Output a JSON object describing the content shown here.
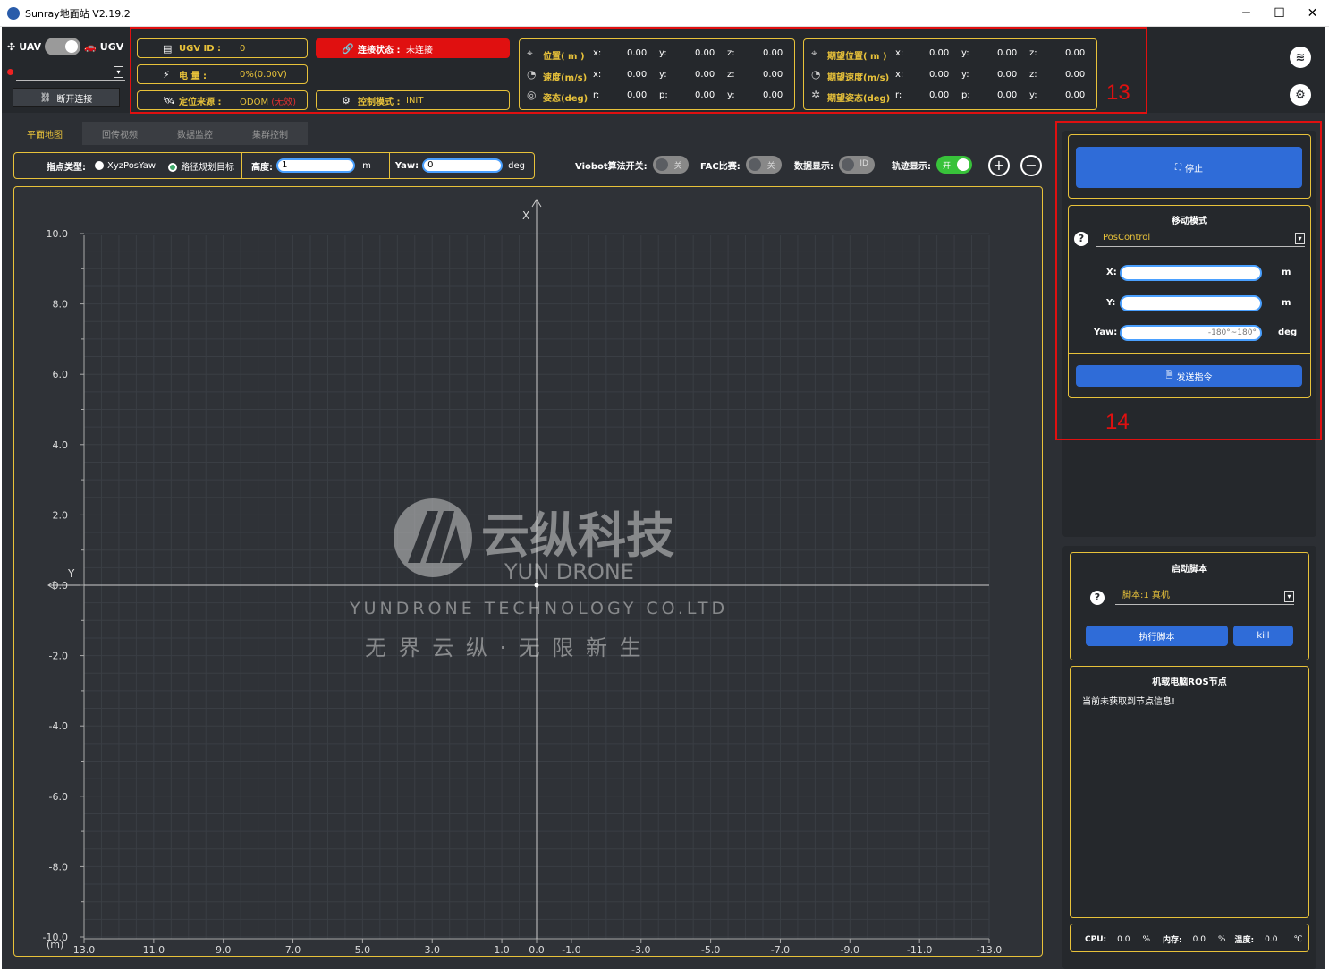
{
  "window": {
    "title": "Sunray地面站 V2.19.2",
    "minimize": "─",
    "maximize": "☐",
    "close": "✕"
  },
  "mode": {
    "uav_label": "UAV",
    "ugv_label": "UGV",
    "disconnect_label": "断开连接"
  },
  "status": {
    "ugv_id_label": "UGV ID :",
    "ugv_id_value": "0",
    "battery_label": "电 量 :",
    "battery_value": "0%(0.00V)",
    "loc_label": "定位来源 :",
    "loc_value": "ODOM",
    "loc_warn": "(无效)",
    "conn_label": "连接状态 :",
    "conn_value": "未连接",
    "ctrl_label": "控制模式 :",
    "ctrl_value": "INIT"
  },
  "state": {
    "pos_label": "位置( m )",
    "vel_label": "速度(m/s)",
    "att_label": "姿态(deg)",
    "axes_xyz": [
      "x:",
      "y:",
      "z:"
    ],
    "axes_rpy": [
      "r:",
      "p:",
      "y:"
    ],
    "pos": [
      "0.00",
      "0.00",
      "0.00"
    ],
    "vel": [
      "0.00",
      "0.00",
      "0.00"
    ],
    "att": [
      "0.00",
      "0.00",
      "0.00"
    ]
  },
  "desired": {
    "pos_label": "期望位置( m )",
    "vel_label": "期望速度(m/s)",
    "att_label": "期望姿态(deg)",
    "pos": [
      "0.00",
      "0.00",
      "0.00"
    ],
    "vel": [
      "0.00",
      "0.00",
      "0.00"
    ],
    "att": [
      "0.00",
      "0.00",
      "0.00"
    ]
  },
  "annotations": {
    "box13": "13",
    "box14": "14"
  },
  "tabs": [
    "平面地图",
    "回传视频",
    "数据监控",
    "集群控制"
  ],
  "map_toolbar": {
    "point_type_label": "指点类型:",
    "opt1": "XyzPosYaw",
    "opt2": "路径规划目标",
    "height_label": "高度:",
    "height_value": "1",
    "height_unit": "m",
    "yaw_label": "Yaw:",
    "yaw_value": "0",
    "yaw_unit": "deg",
    "viobot_label": "Viobot算法开关:",
    "viobot_state": "关",
    "fac_label": "FAC比赛:",
    "fac_state": "关",
    "data_label": "数据显示:",
    "data_state": "ID",
    "track_label": "轨迹显示:",
    "track_state": "开"
  },
  "chart_data": {
    "type": "scatter",
    "xlabel": "Y",
    "ylabel": "X",
    "unit_label": "(m)",
    "x_ticks": [
      "13.0",
      "11.0",
      "9.0",
      "7.0",
      "5.0",
      "3.0",
      "1.0",
      "0.0",
      "-1.0",
      "-3.0",
      "-5.0",
      "-7.0",
      "-9.0",
      "-11.0",
      "-13.0"
    ],
    "x_tick_values": [
      13,
      11,
      9,
      7,
      5,
      3,
      1,
      0,
      -1,
      -3,
      -5,
      -7,
      -9,
      -11,
      -13
    ],
    "y_ticks": [
      "10.0",
      "8.0",
      "6.0",
      "4.0",
      "2.0",
      "0.0",
      "-2.0",
      "-4.0",
      "-6.0",
      "-8.0",
      "-10.0"
    ],
    "y_tick_values": [
      10,
      8,
      6,
      4,
      2,
      0,
      -2,
      -4,
      -6,
      -8,
      -10
    ],
    "xlim": [
      13,
      -13
    ],
    "ylim": [
      -10,
      10
    ],
    "points": [
      {
        "x": 0,
        "y": 0
      }
    ],
    "grid": true
  },
  "watermark": {
    "cn_name": "云纵科技",
    "en_name": "YUN DRONE",
    "company": "YUNDRONE TECHNOLOGY CO.LTD",
    "slogan": "无 界 云 纵 · 无 限 新 生"
  },
  "stop_panel": {
    "stop_label": "停止"
  },
  "move_panel": {
    "title": "移动模式",
    "mode_value": "PosControl",
    "x_label": "X:",
    "x_unit": "m",
    "y_label": "Y:",
    "y_unit": "m",
    "yaw_label": "Yaw:",
    "yaw_placeholder": "-180°~180°",
    "yaw_unit": "deg",
    "send_label": "发送指令"
  },
  "script_panel": {
    "title": "启动脚本",
    "script_value": "脚本:1 真机",
    "run_label": "执行脚本",
    "kill_label": "kill"
  },
  "ros_panel": {
    "title": "机载电脑ROS节点",
    "message": "当前未获取到节点信息!"
  },
  "sysbar": {
    "cpu_label": "CPU:",
    "cpu_value": "0.0",
    "cpu_unit": "%",
    "mem_label": "内存:",
    "mem_value": "0.0",
    "mem_unit": "%",
    "temp_label": "温度:",
    "temp_value": "0.0",
    "temp_unit": "℃"
  },
  "colors": {
    "accent": "#e8c23a",
    "blue": "#2f6cd8",
    "red": "#e01010",
    "green": "#38c23a",
    "bg": "#2c2f34"
  }
}
